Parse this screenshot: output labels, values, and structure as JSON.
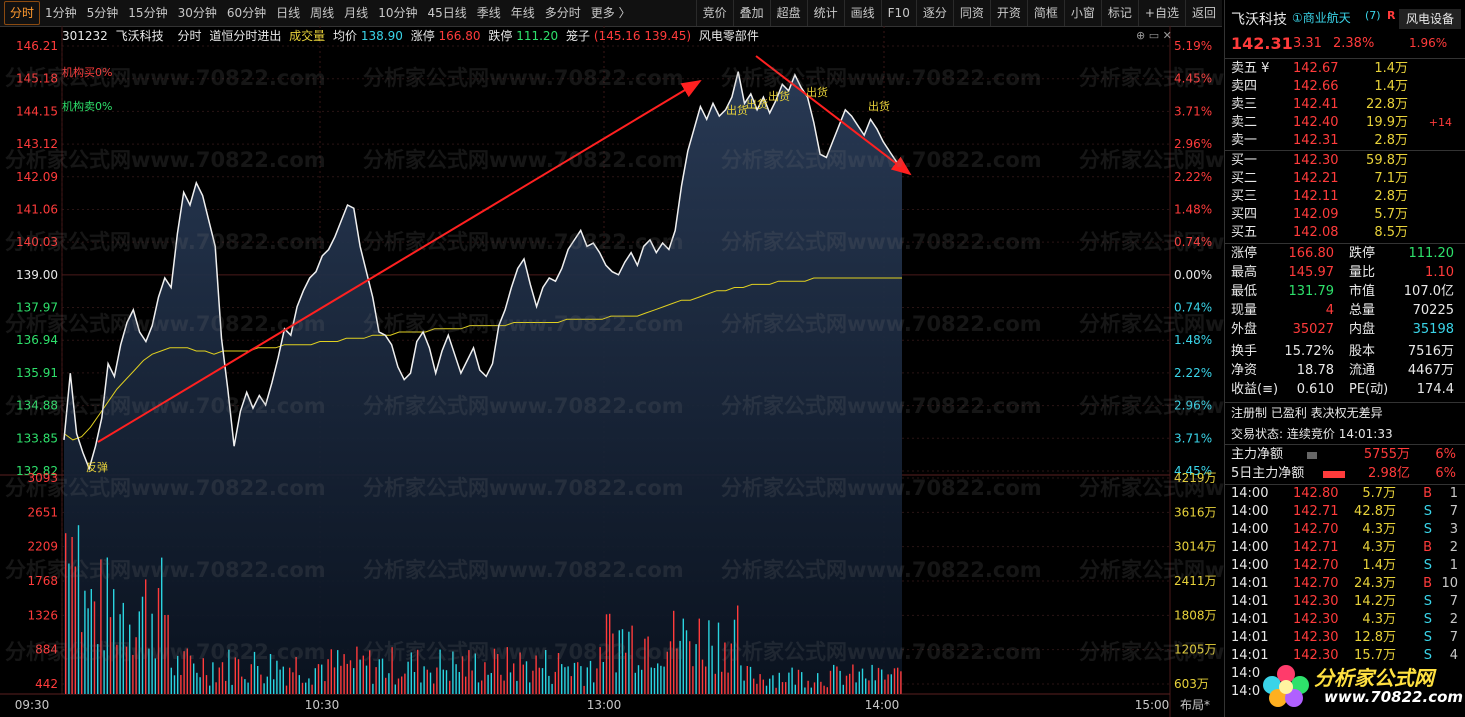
{
  "toolbar": {
    "periods": [
      "分时",
      "1分钟",
      "5分钟",
      "15分钟",
      "30分钟",
      "60分钟",
      "日线",
      "周线",
      "月线",
      "10分钟",
      "45日线",
      "季线",
      "年线",
      "多分时",
      "更多 〉"
    ],
    "active_period": 0,
    "tools": [
      "竞价",
      "叠加",
      "超盘",
      "统计",
      "画线",
      "F10",
      "逐分",
      "同资",
      "开资",
      "简框",
      "小窗",
      "标记",
      "+自选",
      "返回"
    ]
  },
  "info": {
    "code": "301232",
    "name": "飞沃科技",
    "mode": "分时",
    "indicator": "道恒分时进出",
    "volume_label": "成交量",
    "avg_label": "均价",
    "avg_value": "138.90",
    "limit_up_label": "涨停",
    "limit_up_value": "166.80",
    "limit_down_label": "跌停",
    "limit_down_value": "111.20",
    "cage_label": "笼子",
    "cage_value": "(145.16 139.45)",
    "sector": "风电零部件"
  },
  "legend": {
    "inst_buy": "机构买0%",
    "inst_sell": "机构卖0%"
  },
  "annotations": {
    "rebound": "反弹",
    "ship1": "出货",
    "ship2": "出货",
    "ship3": "出货",
    "ship4": "出货",
    "ship5": "出货"
  },
  "chart_data": {
    "type": "line",
    "price_axis": [
      "146.21",
      "145.18",
      "144.15",
      "143.12",
      "142.09",
      "141.06",
      "140.03",
      "139.00",
      "137.97",
      "136.94",
      "135.91",
      "134.88",
      "133.85",
      "132.82"
    ],
    "pct_axis": [
      "5.19%",
      "4.45%",
      "3.71%",
      "2.96%",
      "2.22%",
      "1.48%",
      "0.74%",
      "0.00%",
      "0.74%",
      "1.48%",
      "2.22%",
      "2.96%",
      "3.71%",
      "4.45%"
    ],
    "prev_close": 139.0,
    "price_range": [
      132.82,
      146.21
    ],
    "vol_axis_left": [
      "3093",
      "2651",
      "2209",
      "1768",
      "1326",
      "884",
      "442"
    ],
    "vol_axis_right": [
      "4219万",
      "3616万",
      "3014万",
      "2411万",
      "1808万",
      "1205万",
      "603万"
    ],
    "time_axis": [
      "09:30",
      "10:30",
      "13:00",
      "14:00",
      "15:00"
    ],
    "layout_btn": "布局*",
    "price_series": [
      133.8,
      135.9,
      134.0,
      133.4,
      132.9,
      133.6,
      134.5,
      136.2,
      135.8,
      136.8,
      137.5,
      137.9,
      137.2,
      136.9,
      137.4,
      138.3,
      138.9,
      138.6,
      140.3,
      141.6,
      141.2,
      141.9,
      141.5,
      140.7,
      139.9,
      137.0,
      135.4,
      133.6,
      134.7,
      135.3,
      134.8,
      135.2,
      134.9,
      135.6,
      136.4,
      137.3,
      137.1,
      138.0,
      138.5,
      138.9,
      139.1,
      139.6,
      139.8,
      140.2,
      140.7,
      141.2,
      141.1,
      139.9,
      139.1,
      138.3,
      137.2,
      137.1,
      136.8,
      136.1,
      135.7,
      135.9,
      136.9,
      137.2,
      136.7,
      135.9,
      136.6,
      137.1,
      136.5,
      135.9,
      136.3,
      136.7,
      136.0,
      135.8,
      136.2,
      137.4,
      137.9,
      138.6,
      139.2,
      139.5,
      138.7,
      138.0,
      138.6,
      138.9,
      138.8,
      139.2,
      139.8,
      140.1,
      140.4,
      139.9,
      140.0,
      139.7,
      139.3,
      139.1,
      139.0,
      139.4,
      139.7,
      139.3,
      139.9,
      140.1,
      139.7,
      140.0,
      139.8,
      140.4,
      141.8,
      142.9,
      143.6,
      144.3,
      143.9,
      144.4,
      144.0,
      144.2,
      144.6,
      145.4,
      144.4,
      144.7,
      144.2,
      144.6,
      144.1,
      144.5,
      145.0,
      144.8,
      145.3,
      144.9,
      144.6,
      143.8,
      142.8,
      142.7,
      143.2,
      143.7,
      144.2,
      144.0,
      143.7,
      143.4,
      143.9,
      143.6,
      143.2,
      142.9,
      142.6,
      142.3
    ],
    "avg_series": [
      134.0,
      133.8,
      133.9,
      134.2,
      134.6,
      135.0,
      135.4,
      135.7,
      136.0,
      136.3,
      136.5,
      136.6,
      136.7,
      136.7,
      136.7,
      136.6,
      136.6,
      136.5,
      136.6,
      136.6,
      136.6,
      136.6,
      136.7,
      136.7,
      136.7,
      136.8,
      136.8,
      136.8,
      136.8,
      136.9,
      136.9,
      136.9,
      137.0,
      137.0,
      137.0,
      137.1,
      137.1,
      137.1,
      137.2,
      137.2,
      137.2,
      137.2,
      137.3,
      137.3,
      137.3,
      137.3,
      137.4,
      137.4,
      137.4,
      137.4,
      137.4,
      137.5,
      137.5,
      137.5,
      137.5,
      137.5,
      137.5,
      137.6,
      137.6,
      137.6,
      137.6,
      137.6,
      137.7,
      137.7,
      137.7,
      137.7,
      137.8,
      137.9,
      138.0,
      138.1,
      138.2,
      138.2,
      138.3,
      138.4,
      138.5,
      138.5,
      138.6,
      138.6,
      138.7,
      138.7,
      138.7,
      138.8,
      138.8,
      138.8,
      138.8,
      138.9,
      138.9,
      138.9,
      138.9,
      138.9,
      138.9,
      138.9,
      138.9,
      138.9,
      138.9,
      138.9
    ]
  },
  "quote": {
    "name": "飞沃科技",
    "tag": "①商业航天",
    "tag_count": "(7)",
    "r_flag": "R",
    "sector": "风电设备",
    "price": "142.31",
    "change": "3.31",
    "change_pct": "2.38%",
    "sector_pct": "1.96%"
  },
  "order_book": {
    "asks": [
      {
        "label": "卖五 ¥",
        "price": "142.67",
        "vol": "1.4万",
        "extra": ""
      },
      {
        "label": "卖四",
        "price": "142.66",
        "vol": "1.4万",
        "extra": ""
      },
      {
        "label": "卖三",
        "price": "142.41",
        "vol": "22.8万",
        "extra": ""
      },
      {
        "label": "卖二",
        "price": "142.40",
        "vol": "19.9万",
        "extra": "+14"
      },
      {
        "label": "卖一",
        "price": "142.31",
        "vol": "2.8万",
        "extra": ""
      }
    ],
    "bids": [
      {
        "label": "买一",
        "price": "142.30",
        "vol": "59.8万"
      },
      {
        "label": "买二",
        "price": "142.21",
        "vol": "7.1万"
      },
      {
        "label": "买三",
        "price": "142.11",
        "vol": "2.8万"
      },
      {
        "label": "买四",
        "price": "142.09",
        "vol": "5.7万"
      },
      {
        "label": "买五",
        "price": "142.08",
        "vol": "8.5万"
      }
    ]
  },
  "stats": [
    {
      "l1": "涨停",
      "v1": "166.80",
      "l2": "跌停",
      "v2": "111.20",
      "c1": "red",
      "c2": "green"
    },
    {
      "l1": "最高",
      "v1": "145.97",
      "l2": "量比",
      "v2": "1.10",
      "c1": "red",
      "c2": "red"
    },
    {
      "l1": "最低",
      "v1": "131.79",
      "l2": "市值",
      "v2": "107.0亿",
      "c1": "green",
      "c2": "white"
    },
    {
      "l1": "现量",
      "v1": "4",
      "l2": "总量",
      "v2": "70225",
      "c1": "red",
      "c2": "white"
    },
    {
      "l1": "外盘",
      "v1": "35027",
      "l2": "内盘",
      "v2": "35198",
      "c1": "red",
      "c2": "cyan"
    },
    {
      "l1": "换手",
      "v1": "15.72%",
      "l2": "股本",
      "v2": "7516万",
      "c1": "white",
      "c2": "white"
    },
    {
      "l1": "净资",
      "v1": "18.78",
      "l2": "流通",
      "v2": "4467万",
      "c1": "white",
      "c2": "white"
    },
    {
      "l1": "收益(≡)",
      "v1": "0.610",
      "l2": "PE(动)",
      "v2": "174.4",
      "c1": "white",
      "c2": "white"
    }
  ],
  "notes": {
    "reg": "注册制 已盈利 表决权无差异",
    "status_label": "交易状态:",
    "status_value": "连续竞价 14:01:33"
  },
  "flow": [
    {
      "label": "主力净额",
      "value": "5755万",
      "pct": "6%"
    },
    {
      "label": "5日主力净额",
      "value": "2.98亿",
      "pct": "6%"
    }
  ],
  "ticks": [
    {
      "t": "14:00",
      "p": "142.80",
      "v": "5.7万",
      "s": "B",
      "n": "1"
    },
    {
      "t": "14:00",
      "p": "142.71",
      "v": "42.8万",
      "s": "S",
      "n": "7"
    },
    {
      "t": "14:00",
      "p": "142.70",
      "v": "4.3万",
      "s": "S",
      "n": "3"
    },
    {
      "t": "14:00",
      "p": "142.71",
      "v": "4.3万",
      "s": "B",
      "n": "2"
    },
    {
      "t": "14:00",
      "p": "142.70",
      "v": "1.4万",
      "s": "S",
      "n": "1"
    },
    {
      "t": "14:01",
      "p": "142.70",
      "v": "24.3万",
      "s": "B",
      "n": "10"
    },
    {
      "t": "14:01",
      "p": "142.30",
      "v": "14.2万",
      "s": "S",
      "n": "7"
    },
    {
      "t": "14:01",
      "p": "142.30",
      "v": "4.3万",
      "s": "S",
      "n": "2"
    },
    {
      "t": "14:01",
      "p": "142.30",
      "v": "12.8万",
      "s": "S",
      "n": "7"
    },
    {
      "t": "14:01",
      "p": "142.30",
      "v": "15.7万",
      "s": "S",
      "n": "4"
    },
    {
      "t": "14:0",
      "p": "",
      "v": "",
      "s": "",
      "n": ""
    },
    {
      "t": "14:0",
      "p": "",
      "v": "",
      "s": "",
      "n": ""
    }
  ],
  "logo": {
    "text": "分析家公式网",
    "url": "www.70822.com"
  },
  "watermark": "分析家公式网www.70822.com"
}
